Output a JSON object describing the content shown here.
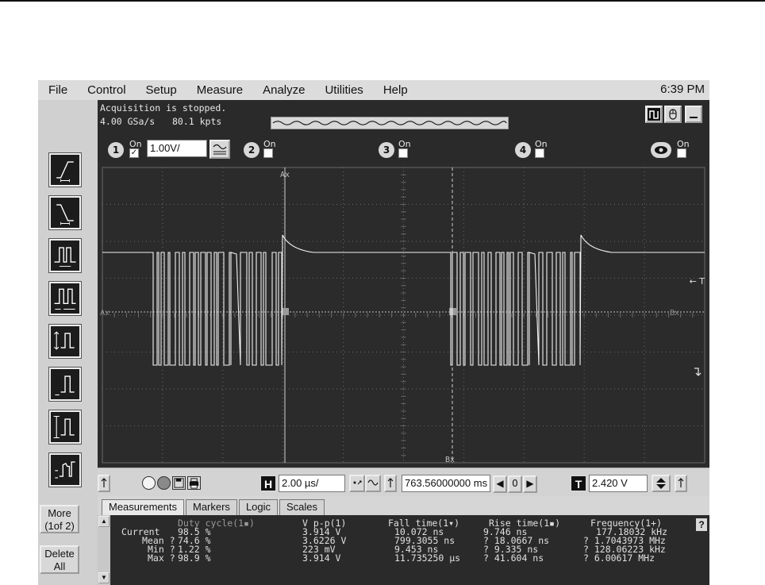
{
  "menu": {
    "items": [
      "File",
      "Control",
      "Setup",
      "Measure",
      "Analyze",
      "Utilities",
      "Help"
    ],
    "clock": "6:39 PM"
  },
  "status": {
    "line1": "Acquisition is stopped.",
    "sample_rate": "4.00 GSa/s",
    "memory_depth": "80.1 kpts"
  },
  "channels": {
    "ch1": {
      "number": "1",
      "on_label": "On",
      "enabled": true,
      "scale": "1.00V/"
    },
    "ch2": {
      "number": "2",
      "on_label": "On",
      "enabled": false
    },
    "ch3": {
      "number": "3",
      "on_label": "On",
      "enabled": false
    },
    "ch4": {
      "number": "4",
      "on_label": "On",
      "enabled": false
    },
    "math": {
      "on_label": "On",
      "enabled": false
    }
  },
  "graticule": {
    "marker_ax_top": "Ax",
    "marker_ax_left": "Ax",
    "marker_bx_right": "Bx",
    "marker_bx_bottom": "Bx",
    "trigger_label": "← T"
  },
  "left_panel": {
    "more_line1": "More",
    "more_line2": "(1of 2)",
    "delete_line1": "Delete",
    "delete_line2": "All"
  },
  "timebase": {
    "scale": "2.00 µs/",
    "position": "763.56000000 ms",
    "h_label": "H",
    "t_label": "T",
    "trigger_level": "2.420 V"
  },
  "tabs": [
    "Measurements",
    "Markers",
    "Logic",
    "Scales"
  ],
  "measurements": {
    "row_labels": [
      "",
      "Current",
      "Mean ?",
      "Min ?",
      "Max ?"
    ],
    "columns": [
      {
        "header": "Duty cycle(1▪)",
        "values": [
          "98.5 %",
          "74.6 %",
          "1.22 %",
          "98.9 %"
        ]
      },
      {
        "header": "V p-p(1)",
        "values": [
          "3.914 V",
          "3.6226 V",
          "223 mV",
          "3.914 V"
        ]
      },
      {
        "header": "Fall time(1▾)",
        "values": [
          "10.072 ns",
          "799.3055 ns",
          "9.453 ns",
          "11.735250 µs"
        ]
      },
      {
        "header": "Rise time(1▪)",
        "values": [
          "9.746 ns",
          "? 18.0667 ns",
          "? 9.335 ns",
          "? 41.604 ns"
        ]
      },
      {
        "header": "Frequency(1+)",
        "values": [
          "177.18032 kHz",
          "? 1.7043973 MHz",
          "? 128.06223 kHz",
          "? 6.00617 MHz"
        ]
      }
    ],
    "help": "?"
  },
  "colors": {
    "screen_bg": "#2b2b2b",
    "trace": "#f2f2f2",
    "grid": "#6a6a6a",
    "panel": "#d6d6d6"
  }
}
